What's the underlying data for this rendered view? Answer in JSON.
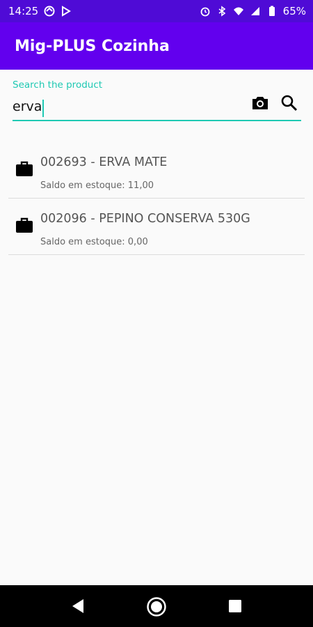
{
  "status_bar": {
    "time": "14:25",
    "battery": "65%",
    "left_icons": [
      "sync-icon",
      "play-store-icon"
    ],
    "right_icons": [
      "alarm-icon",
      "bluetooth-icon",
      "wifi-icon",
      "signal-icon",
      "battery-icon"
    ]
  },
  "app_bar": {
    "title": "Mig-PLUS Cozinha"
  },
  "search": {
    "label": "Search the product",
    "value": "erva",
    "camera_icon": "camera-icon",
    "search_icon": "search-icon"
  },
  "products": [
    {
      "title": "002693 - ERVA MATE",
      "subtitle": "Saldo em estoque: 11,00",
      "icon": "briefcase-icon"
    },
    {
      "title": "002096 - PEPINO CONSERVA 530G",
      "subtitle": "Saldo em estoque: 0,00",
      "icon": "briefcase-icon"
    }
  ],
  "nav_bar": {
    "icons": [
      "back-icon",
      "home-icon",
      "recents-icon"
    ]
  },
  "colors": {
    "primary": "#6200ee",
    "primary_dark": "#4f0bd6",
    "accent": "#1ec9b3"
  }
}
